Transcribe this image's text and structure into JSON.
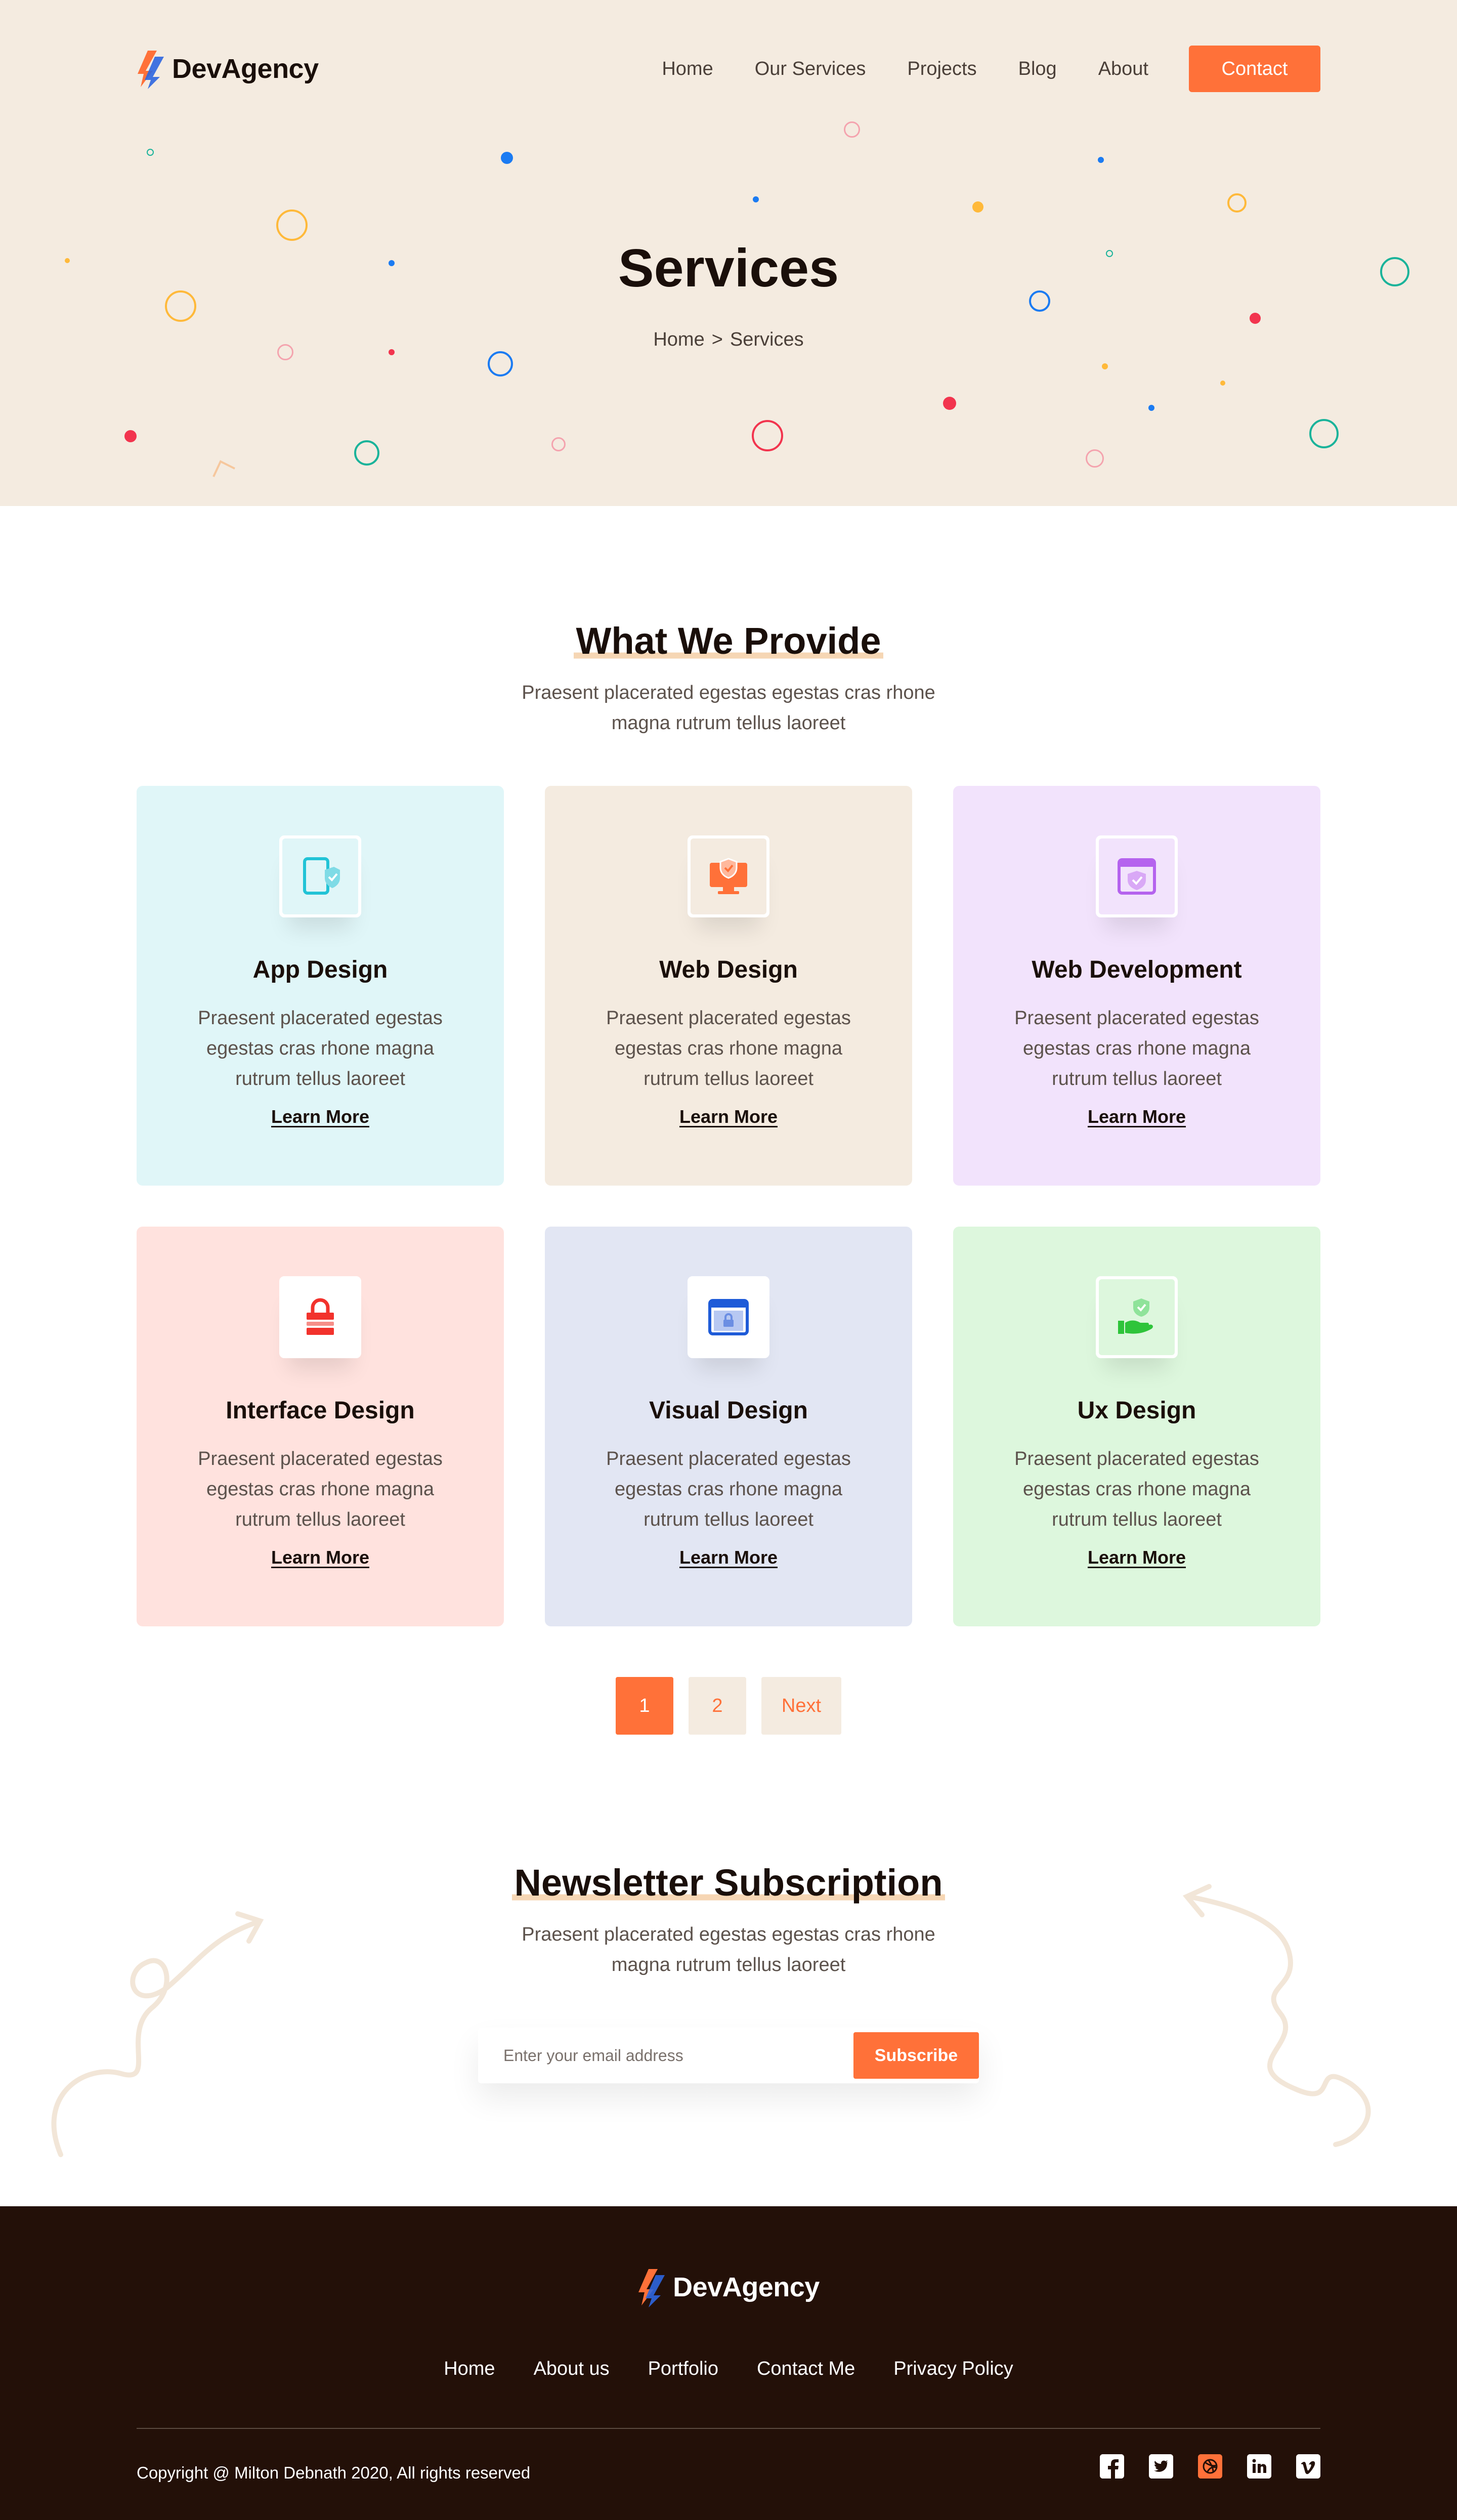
{
  "brand": {
    "name": "DevAgency"
  },
  "nav": {
    "items": [
      "Home",
      "Our Services",
      "Projects",
      "Blog",
      "About"
    ],
    "contact_label": "Contact"
  },
  "hero": {
    "title": "Services",
    "breadcrumb": {
      "home": "Home",
      "separator": ">",
      "current": "Services"
    }
  },
  "services": {
    "title": "What We Provide",
    "subtitle_line1": "Praesent placerated egestas egestas cras rhone",
    "subtitle_line2": "magna rutrum tellus laoreet",
    "cards": [
      {
        "title": "App Design",
        "text": "Praesent placerated egestas egestas cras rhone magna rutrum tellus laoreet",
        "link": "Learn More",
        "bg": "#e0f6f8",
        "icon": "tablet-shield-icon",
        "icon_color": "#22c3d6"
      },
      {
        "title": "Web Design",
        "text": "Praesent placerated egestas egestas cras rhone magna rutrum tellus laoreet",
        "link": "Learn More",
        "bg": "#f4ebe0",
        "icon": "monitor-shield-icon",
        "icon_color": "#ff7139"
      },
      {
        "title": "Web Development",
        "text": "Praesent placerated egestas egestas cras rhone magna rutrum tellus laoreet",
        "link": "Learn More",
        "bg": "#f2e3fc",
        "icon": "browser-shield-icon",
        "icon_color": "#b563ee"
      },
      {
        "title": "Interface Design",
        "text": "Praesent placerated egestas egestas cras rhone magna rutrum tellus laoreet",
        "link": "Learn More",
        "bg": "#ffe2de",
        "icon": "lock-bars-icon",
        "icon_color": "#f2322c"
      },
      {
        "title": "Visual Design",
        "text": "Praesent placerated egestas egestas cras rhone magna rutrum tellus laoreet",
        "link": "Learn More",
        "bg": "#e2e6f3",
        "icon": "window-lock-icon",
        "icon_color": "#1e5bd8"
      },
      {
        "title": "Ux Design",
        "text": "Praesent placerated egestas egestas cras rhone magna rutrum tellus laoreet",
        "link": "Learn More",
        "bg": "#ddf7dd",
        "icon": "hand-shield-icon",
        "icon_color": "#2ec43a"
      }
    ]
  },
  "pagination": {
    "pages": [
      "1",
      "2"
    ],
    "next_label": "Next",
    "current": "1"
  },
  "newsletter": {
    "title": "Newsletter Subscription",
    "subtitle_line1": "Praesent placerated egestas egestas cras rhone",
    "subtitle_line2": "magna rutrum tellus laoreet",
    "placeholder": "Enter your email address",
    "button_label": "Subscribe"
  },
  "footer": {
    "links": [
      "Home",
      "About us",
      "Portfolio",
      "Contact Me",
      "Privacy Policy"
    ],
    "copyright": "Copyright @ Milton Debnath 2020, All rights reserved",
    "socials": [
      "facebook-icon",
      "twitter-icon",
      "dribbble-icon",
      "linkedin-icon",
      "vimeo-icon"
    ]
  },
  "colors": {
    "accent": "#ff7139",
    "hero_bg": "#f4ebe0",
    "footer_bg": "#231008"
  }
}
